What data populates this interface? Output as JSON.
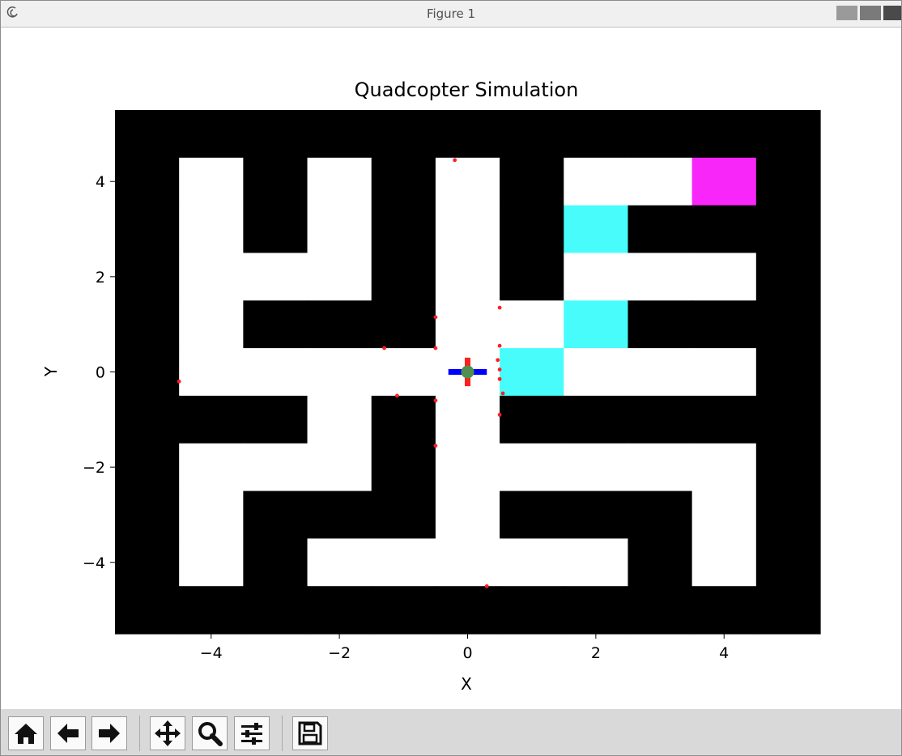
{
  "window": {
    "title": "Figure 1"
  },
  "toolbar": {
    "buttons": [
      {
        "name": "home",
        "icon": "home-icon"
      },
      {
        "name": "back",
        "icon": "arrow-left-icon"
      },
      {
        "name": "forward",
        "icon": "arrow-right-icon"
      },
      {
        "name": "pan",
        "icon": "move-icon"
      },
      {
        "name": "zoom",
        "icon": "zoom-icon"
      },
      {
        "name": "configure-subplots",
        "icon": "sliders-icon"
      },
      {
        "name": "save",
        "icon": "save-icon"
      }
    ]
  },
  "chart_data": {
    "type": "heatmap",
    "title": "Quadcopter Simulation",
    "xlabel": "X",
    "ylabel": "Y",
    "xlim": [
      -5.5,
      5.5
    ],
    "ylim": [
      -5.5,
      5.5
    ],
    "xticks": [
      -4,
      -2,
      0,
      2,
      4
    ],
    "yticks": [
      -4,
      -2,
      0,
      2,
      4
    ],
    "xtick_labels": [
      "−4",
      "−2",
      "0",
      "2",
      "4"
    ],
    "ytick_labels": [
      "−4",
      "−2",
      "0",
      "2",
      "4"
    ],
    "grid": false,
    "colors": {
      "wall": "#000000",
      "free": "#ffffff",
      "visited": "#48fcfc",
      "goal": "#f826f8",
      "arm_x": "#0000ff",
      "arm_y": "#ff2020",
      "body": "#4f8f4f",
      "sensor": "#ff2020"
    },
    "cell_legend": {
      "0": "free",
      "1": "wall",
      "2": "visited",
      "3": "goal"
    },
    "grid_rows_top_to_bottom": [
      [
        1,
        1,
        1,
        1,
        1,
        1,
        1,
        1,
        1,
        1,
        1
      ],
      [
        1,
        0,
        1,
        0,
        1,
        0,
        1,
        0,
        0,
        3,
        1
      ],
      [
        1,
        0,
        1,
        0,
        1,
        0,
        1,
        2,
        1,
        1,
        1
      ],
      [
        1,
        0,
        0,
        0,
        1,
        0,
        1,
        0,
        0,
        0,
        1
      ],
      [
        1,
        0,
        1,
        1,
        1,
        0,
        0,
        2,
        1,
        1,
        1
      ],
      [
        1,
        0,
        0,
        0,
        0,
        0,
        2,
        0,
        0,
        0,
        1
      ],
      [
        1,
        1,
        1,
        0,
        1,
        0,
        1,
        1,
        1,
        1,
        1
      ],
      [
        1,
        0,
        0,
        0,
        1,
        0,
        0,
        0,
        0,
        0,
        1
      ],
      [
        1,
        0,
        1,
        1,
        1,
        0,
        1,
        1,
        1,
        0,
        1
      ],
      [
        1,
        0,
        1,
        0,
        0,
        0,
        0,
        0,
        1,
        0,
        1
      ],
      [
        1,
        1,
        1,
        1,
        1,
        1,
        1,
        1,
        1,
        1,
        1
      ]
    ],
    "quadcopter": {
      "x": 0.0,
      "y": 0.0,
      "arm_length": 0.3
    },
    "sensor_points": [
      {
        "x": -0.2,
        "y": 4.45
      },
      {
        "x": -0.5,
        "y": 1.15
      },
      {
        "x": 0.5,
        "y": 1.35
      },
      {
        "x": -1.3,
        "y": 0.5
      },
      {
        "x": -0.5,
        "y": 0.5
      },
      {
        "x": 0.5,
        "y": 0.55
      },
      {
        "x": 0.47,
        "y": 0.25
      },
      {
        "x": 0.5,
        "y": 0.05
      },
      {
        "x": 0.5,
        "y": -0.15
      },
      {
        "x": 0.55,
        "y": -0.45
      },
      {
        "x": -4.5,
        "y": -0.2
      },
      {
        "x": -1.1,
        "y": -0.5
      },
      {
        "x": -0.5,
        "y": -0.6
      },
      {
        "x": 0.5,
        "y": -0.9
      },
      {
        "x": -0.5,
        "y": -1.55
      },
      {
        "x": 0.3,
        "y": -4.5
      }
    ]
  }
}
